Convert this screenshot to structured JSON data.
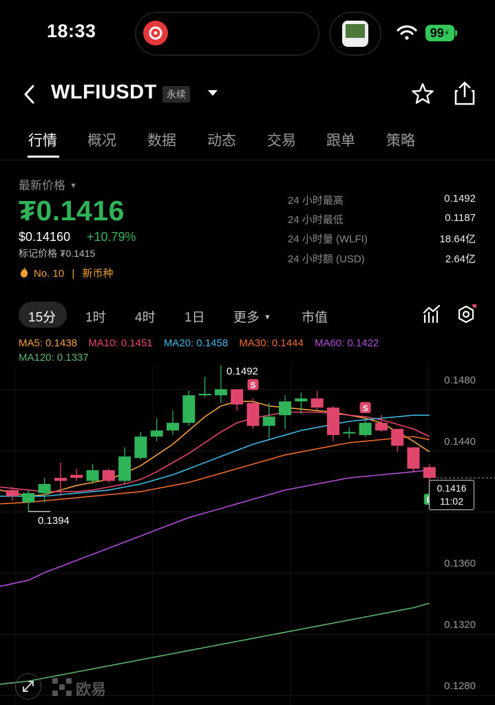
{
  "status_bar": {
    "time": "18:33",
    "battery": "99"
  },
  "header": {
    "symbol": "WLFIUSDT",
    "contract_tag": "永续"
  },
  "tabs": [
    "行情",
    "概况",
    "数据",
    "动态",
    "交易",
    "跟单",
    "策略"
  ],
  "price_panel": {
    "latest_label": "最新价格",
    "price": "₮0.1416",
    "usd_price": "$0.14160",
    "change_pct": "+10.79%",
    "mark_price": "标记价格 ₮0.1415",
    "rank": "No. 10",
    "separator": "|",
    "new_coin": "新币种"
  },
  "stats": [
    {
      "label": "24 小时最高",
      "value": "0.1492"
    },
    {
      "label": "24 小时最低",
      "value": "0.1187"
    },
    {
      "label": "24 小时量 (WLFI)",
      "value": "18.64亿"
    },
    {
      "label": "24 小时额 (USD)",
      "value": "2.64亿"
    }
  ],
  "intervals": {
    "selected": "15分",
    "items": [
      "15分",
      "1时",
      "4时",
      "1日",
      "更多",
      "市值"
    ]
  },
  "ma_legend": [
    {
      "text": "MA5: 0.1438",
      "color": "#f6a03c"
    },
    {
      "text": "MA10: 0.1451",
      "color": "#e9446a"
    },
    {
      "text": "MA20: 0.1458",
      "color": "#3fb9e3"
    },
    {
      "text": "MA30: 0.1444",
      "color": "#f06a2a"
    },
    {
      "text": "MA60: 0.1422",
      "color": "#b14ed8"
    },
    {
      "text": "MA120: 0.1337",
      "color": "#5bb56a"
    }
  ],
  "chart_data": {
    "type": "candlestick",
    "y_axis_labels": [
      "0.1480",
      "0.1440",
      "0.1360",
      "0.1320",
      "0.1280"
    ],
    "high_marker": "0.1492",
    "low_marker": "0.1394",
    "current_price": "0.1416",
    "countdown": "11:02",
    "signals": [
      "S",
      "S",
      "B"
    ],
    "candles": [
      {
        "o": 0.1408,
        "h": 0.141,
        "l": 0.1401,
        "c": 0.1404
      },
      {
        "o": 0.14,
        "h": 0.1408,
        "l": 0.1394,
        "c": 0.1406
      },
      {
        "o": 0.1406,
        "h": 0.1416,
        "l": 0.14,
        "c": 0.1412
      },
      {
        "o": 0.1416,
        "h": 0.1426,
        "l": 0.1404,
        "c": 0.1414
      },
      {
        "o": 0.1418,
        "h": 0.1422,
        "l": 0.1414,
        "c": 0.1416
      },
      {
        "o": 0.1414,
        "h": 0.1425,
        "l": 0.1412,
        "c": 0.1421
      },
      {
        "o": 0.1421,
        "h": 0.1422,
        "l": 0.1413,
        "c": 0.1414
      },
      {
        "o": 0.1414,
        "h": 0.1436,
        "l": 0.1412,
        "c": 0.143
      },
      {
        "o": 0.1429,
        "h": 0.1446,
        "l": 0.1428,
        "c": 0.1443
      },
      {
        "o": 0.1443,
        "h": 0.1455,
        "l": 0.144,
        "c": 0.1447
      },
      {
        "o": 0.1447,
        "h": 0.146,
        "l": 0.1444,
        "c": 0.1452
      },
      {
        "o": 0.1452,
        "h": 0.1473,
        "l": 0.145,
        "c": 0.147
      },
      {
        "o": 0.147,
        "h": 0.1482,
        "l": 0.1469,
        "c": 0.1471
      },
      {
        "o": 0.147,
        "h": 0.1491,
        "l": 0.1465,
        "c": 0.1474
      },
      {
        "o": 0.1474,
        "h": 0.1473,
        "l": 0.146,
        "c": 0.1464
      },
      {
        "o": 0.1465,
        "h": 0.1468,
        "l": 0.1448,
        "c": 0.145
      },
      {
        "o": 0.145,
        "h": 0.1465,
        "l": 0.1442,
        "c": 0.1456
      },
      {
        "o": 0.1457,
        "h": 0.147,
        "l": 0.1448,
        "c": 0.1466
      },
      {
        "o": 0.1466,
        "h": 0.1472,
        "l": 0.1458,
        "c": 0.1468
      },
      {
        "o": 0.1468,
        "h": 0.1473,
        "l": 0.146,
        "c": 0.1462
      },
      {
        "o": 0.1462,
        "h": 0.1463,
        "l": 0.144,
        "c": 0.1444
      },
      {
        "o": 0.1445,
        "h": 0.1449,
        "l": 0.1442,
        "c": 0.1446
      },
      {
        "o": 0.1444,
        "h": 0.1455,
        "l": 0.1443,
        "c": 0.1452
      },
      {
        "o": 0.1452,
        "h": 0.1457,
        "l": 0.1446,
        "c": 0.1447
      },
      {
        "o": 0.1448,
        "h": 0.1446,
        "l": 0.1433,
        "c": 0.1437
      },
      {
        "o": 0.1436,
        "h": 0.1436,
        "l": 0.142,
        "c": 0.1422
      },
      {
        "o": 0.1423,
        "h": 0.1425,
        "l": 0.1413,
        "c": 0.1416
      }
    ],
    "ma_series": {
      "MA5": [
        0.1408,
        0.1404,
        0.1405,
        0.1408,
        0.1411,
        0.1413,
        0.1415,
        0.1419,
        0.1424,
        0.1431,
        0.1438,
        0.1447,
        0.1456,
        0.1463,
        0.1466,
        0.1466,
        0.1463,
        0.1462,
        0.1461,
        0.146,
        0.1459,
        0.1457,
        0.1455,
        0.1452,
        0.1446,
        0.144,
        0.1433
      ],
      "MA10": [
        0.141,
        0.1408,
        0.1407,
        0.1407,
        0.1407,
        0.1408,
        0.141,
        0.1412,
        0.1415,
        0.142,
        0.1426,
        0.1432,
        0.1439,
        0.1446,
        0.1452,
        0.1455,
        0.1457,
        0.1459,
        0.1459,
        0.1459,
        0.1458,
        0.1457,
        0.1456,
        0.1454,
        0.1451,
        0.1448,
        0.1443
      ],
      "MA20": [
        0.1404,
        0.1404,
        0.1404,
        0.1405,
        0.1406,
        0.1407,
        0.1408,
        0.141,
        0.1412,
        0.1415,
        0.1418,
        0.1422,
        0.1426,
        0.143,
        0.1434,
        0.1438,
        0.1441,
        0.1444,
        0.1447,
        0.1449,
        0.1451,
        0.1453,
        0.1454,
        0.1455,
        0.1456,
        0.1457,
        0.1457
      ],
      "MA30": [
        0.1399,
        0.14,
        0.1401,
        0.1402,
        0.1403,
        0.1404,
        0.1405,
        0.1406,
        0.1407,
        0.1409,
        0.1411,
        0.1413,
        0.1416,
        0.1419,
        0.1422,
        0.1425,
        0.1428,
        0.1431,
        0.1433,
        0.1435,
        0.1437,
        0.1439,
        0.144,
        0.1441,
        0.1442,
        0.1443,
        0.1441
      ],
      "MA60": [
        0.1345,
        0.1349,
        0.1354,
        0.1358,
        0.1362,
        0.1366,
        0.137,
        0.1374,
        0.1378,
        0.1382,
        0.1386,
        0.139,
        0.1393,
        0.1396,
        0.1399,
        0.1402,
        0.1405,
        0.1408,
        0.141,
        0.1412,
        0.1414,
        0.1416,
        0.1417,
        0.1418,
        0.1419,
        0.142,
        0.1421
      ],
      "MA120": [
        0.1281,
        0.1283,
        0.1285,
        0.1287,
        0.1289,
        0.1291,
        0.1293,
        0.1295,
        0.1297,
        0.1299,
        0.1301,
        0.1303,
        0.1305,
        0.1307,
        0.1309,
        0.1311,
        0.1313,
        0.1315,
        0.1317,
        0.1319,
        0.1321,
        0.1323,
        0.1325,
        0.1327,
        0.1329,
        0.1331,
        0.1334
      ]
    },
    "up_color": "#2fb45a",
    "down_color": "#e0466c"
  },
  "watermark": "欧易"
}
